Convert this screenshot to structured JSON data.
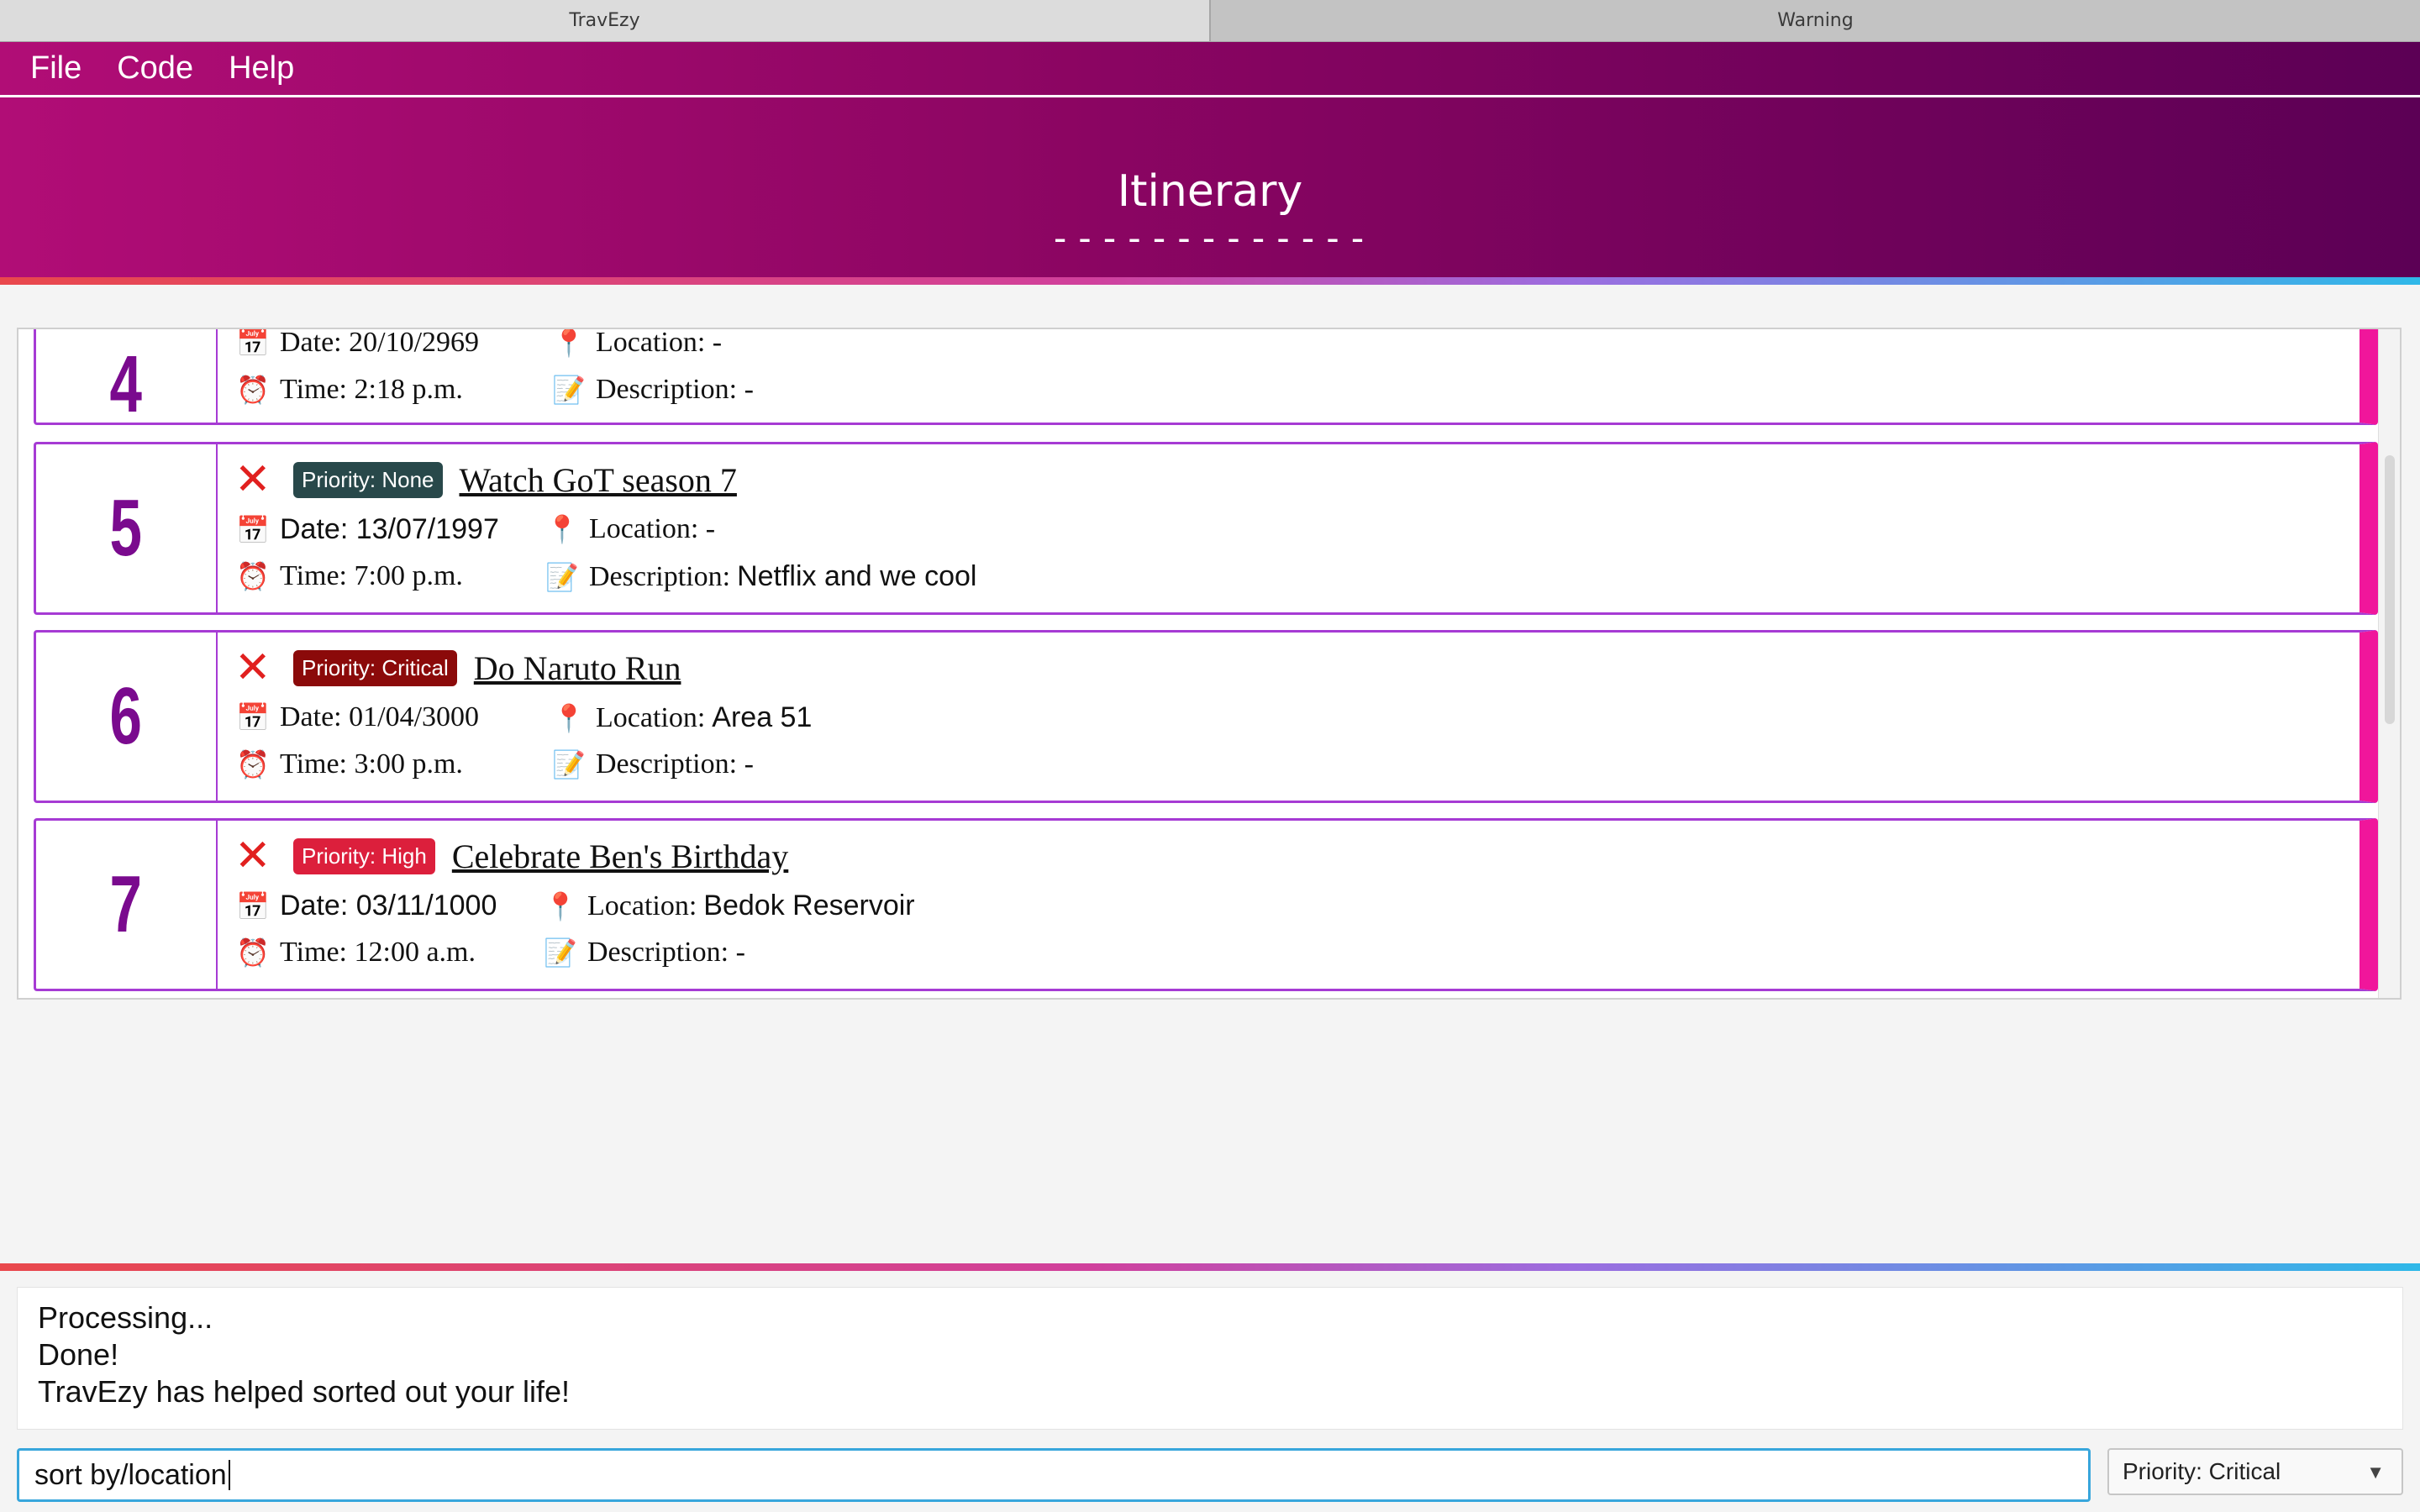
{
  "tabs": [
    {
      "label": "TravEzy"
    },
    {
      "label": "Warning"
    }
  ],
  "menu": {
    "file": "File",
    "code": "Code",
    "help": "Help"
  },
  "header": {
    "title": "Itinerary",
    "underline": "-------------"
  },
  "icons": {
    "delete": "cross-mark-icon",
    "date": "calendar-icon",
    "location": "round-pushpin-icon",
    "time": "alarm-clock-icon",
    "description": "memo-icon"
  },
  "colors": {
    "accent": "#a63bd4",
    "card_stripe": "#f0169b",
    "priority_none": "#28484a",
    "priority_critical": "#8b0a0a",
    "priority_high": "#dc1f3c"
  },
  "items": [
    {
      "index": "4",
      "date": "Date: 20/10/2969",
      "time": "Time: 2:18 p.m.",
      "location": "Location: -",
      "description": "Description: -"
    },
    {
      "index": "5",
      "priority": "Priority: None",
      "name": "Watch GoT season 7",
      "date": "Date: 13/07/1997",
      "time": "Time: 7:00 p.m.",
      "location": "Location: -",
      "description_label": "Description: ",
      "description_value": "Netflix and we cool"
    },
    {
      "index": "6",
      "priority": "Priority: Critical",
      "name": "Do Naruto Run",
      "date": "Date: 01/04/3000",
      "time": "Time: 3:00 p.m.",
      "location_label": "Location: ",
      "location_value": "Area 51",
      "description": "Description: -"
    },
    {
      "index": "7",
      "priority": "Priority: High",
      "name": "Celebrate Ben's Birthday",
      "date": "Date: 03/11/1000",
      "time": "Time: 12:00 a.m.",
      "location_label": "Location: ",
      "location_value": "Bedok Reservoir",
      "description": "Description: -"
    }
  ],
  "output": {
    "lines": [
      "Processing...",
      "Done!",
      "TravEzy has helped sorted out your life!"
    ]
  },
  "command": {
    "value": "sort by/location"
  },
  "priority_select": {
    "selected": "Priority: Critical"
  }
}
